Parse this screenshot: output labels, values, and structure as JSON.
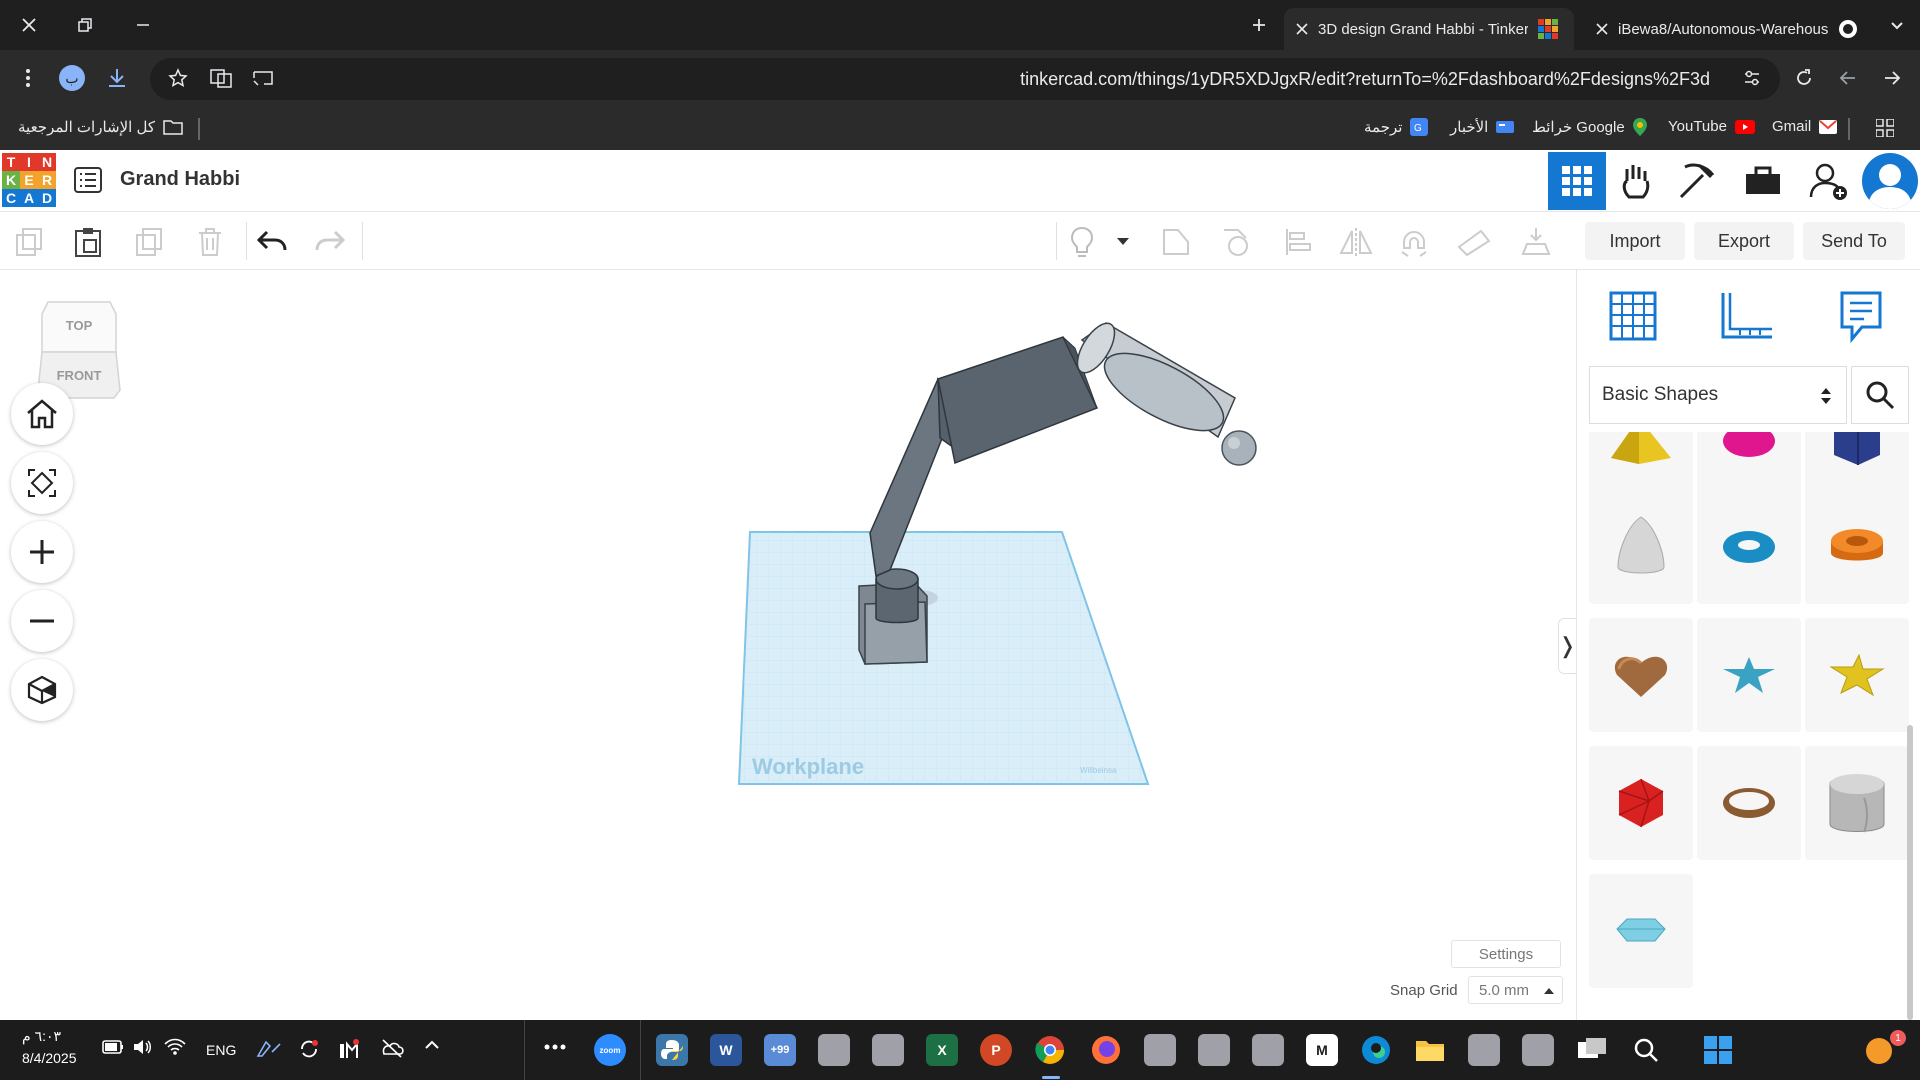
{
  "browser": {
    "tabs": [
      {
        "title": "3D design Grand Habbi - Tinker",
        "active": true
      },
      {
        "title": "iBewa8/Autonomous-Warehous",
        "active": false
      }
    ],
    "url": "tinkercad.com/things/1yDR5XDJgxR/edit?returnTo=%2Fdashboard%2Fdesigns%2F3d",
    "profile_initial": "ب",
    "bookmarks": [
      {
        "label": "Gmail",
        "icon": "gmail-icon"
      },
      {
        "label": "YouTube",
        "icon": "youtube-icon"
      },
      {
        "label": "خرائط Google",
        "icon": "maps-icon"
      },
      {
        "label": "الأخبار",
        "icon": "news-icon"
      },
      {
        "label": "ترجمة",
        "icon": "translate-icon"
      }
    ],
    "all_bookmarks_label": "كل الإشارات المرجعية"
  },
  "app": {
    "logo_letters": [
      "T",
      "I",
      "N",
      "K",
      "E",
      "R",
      "C",
      "A",
      "D"
    ],
    "design_title": "Grand Habbi",
    "toolbar": {
      "import_label": "Import",
      "export_label": "Export",
      "send_to_label": "Send To"
    },
    "viewcube": {
      "top_label": "TOP",
      "front_label": "FRONT"
    },
    "workplane_label": "Workplane",
    "workplane_brand": "Willbeinsa",
    "settings_label": "Settings",
    "snap_grid_label": "Snap Grid",
    "snap_grid_value": "5.0 mm",
    "shapes_library": "Basic Shapes",
    "collapse_glyph": "❭"
  },
  "colors": {
    "accent": "#1477d1",
    "workplane": "#d9eef8",
    "arm": "#6b7680"
  },
  "taskbar": {
    "time": "٦:٠٣ م",
    "date": "8/4/2025",
    "lang": "ENG",
    "badge": "+99",
    "notif": "1"
  }
}
